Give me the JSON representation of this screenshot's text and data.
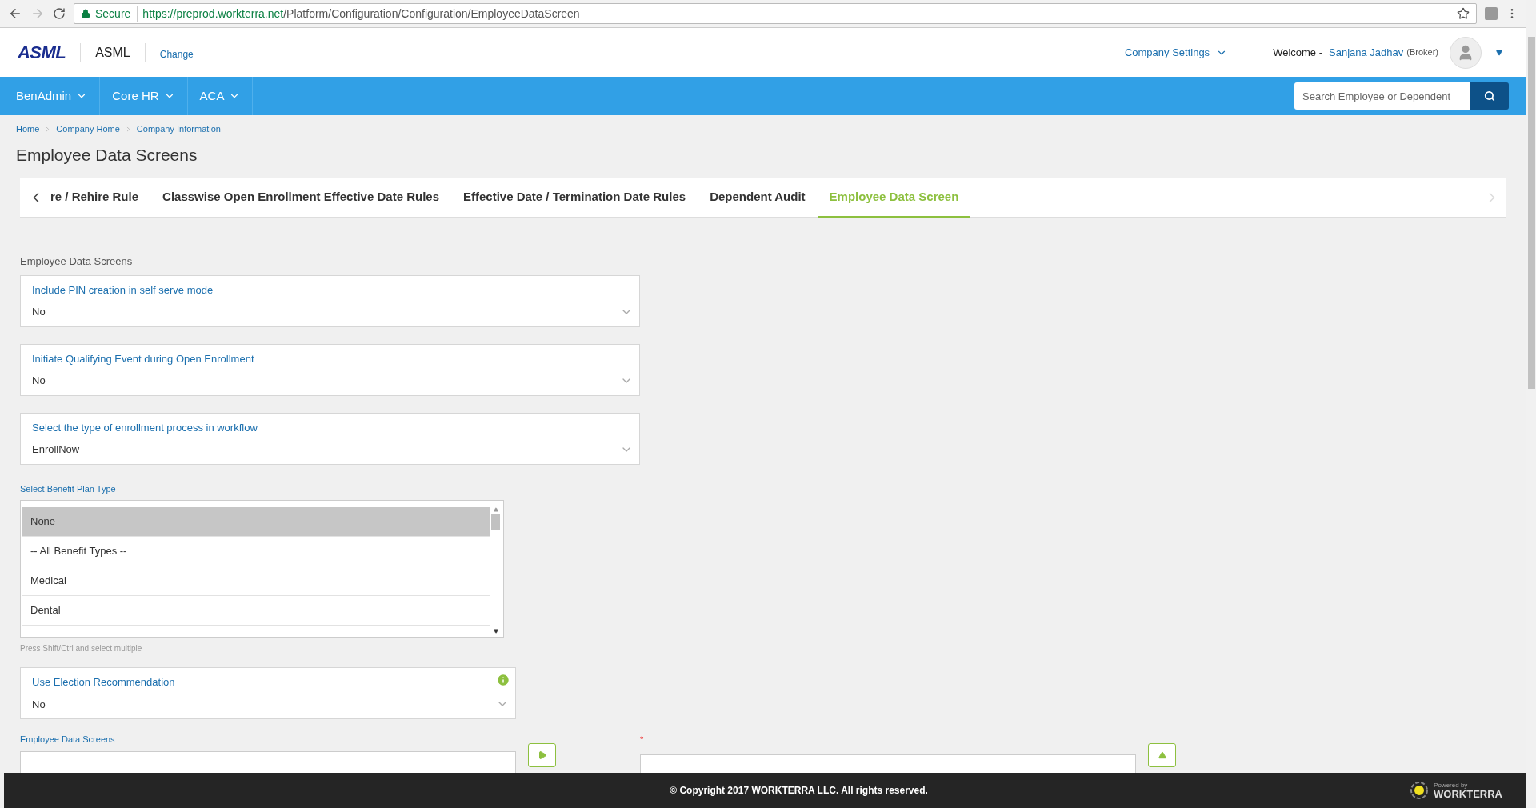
{
  "browser": {
    "secure_label": "Secure",
    "url_host": "https://preprod.workterra.net",
    "url_path": "/Platform/Configuration/Configuration/EmployeeDataScreen"
  },
  "header": {
    "logo": "ASML",
    "company": "ASML",
    "change_link": "Change",
    "company_settings": "Company Settings",
    "welcome": "Welcome -",
    "user_name": "Sanjana Jadhav",
    "user_role": "(Broker)"
  },
  "nav": {
    "items": [
      {
        "label": "BenAdmin"
      },
      {
        "label": "Core HR"
      },
      {
        "label": "ACA"
      }
    ],
    "search_placeholder": "Search Employee or Dependent"
  },
  "breadcrumb": [
    "Home",
    "Company Home",
    "Company Information"
  ],
  "page_title": "Employee Data Screens",
  "tabs": [
    {
      "label": "re / Rehire Rule",
      "selected": false
    },
    {
      "label": "Classwise Open Enrollment Effective Date Rules",
      "selected": false
    },
    {
      "label": "Effective Date / Termination Date Rules",
      "selected": false
    },
    {
      "label": "Dependent Audit",
      "selected": false
    },
    {
      "label": "Employee Data Screen",
      "selected": true
    }
  ],
  "section_label": "Employee Data Screens",
  "selects": [
    {
      "label": "Include PIN creation in self serve mode",
      "value": "No"
    },
    {
      "label": "Initiate Qualifying Event during Open Enrollment",
      "value": "No"
    },
    {
      "label": "Select the type of enrollment process in workflow",
      "value": "EnrollNow"
    }
  ],
  "benefit_plan": {
    "label": "Select Benefit Plan Type",
    "options": [
      {
        "label": "None",
        "selected": true
      },
      {
        "label": "-- All Benefit Types --",
        "selected": false
      },
      {
        "label": "Medical",
        "selected": false
      },
      {
        "label": "Dental",
        "selected": false
      }
    ],
    "hint": "Press Shift/Ctrl and select multiple"
  },
  "election": {
    "label": "Use Election Recommendation",
    "value": "No"
  },
  "data_screens": {
    "label": "Employee Data Screens",
    "required_mark": "*"
  },
  "footer": {
    "copyright": "© Copyright 2017 WORKTERRA LLC. All rights reserved.",
    "powered_by": "Powered by",
    "brand": "WORKTERRA"
  }
}
